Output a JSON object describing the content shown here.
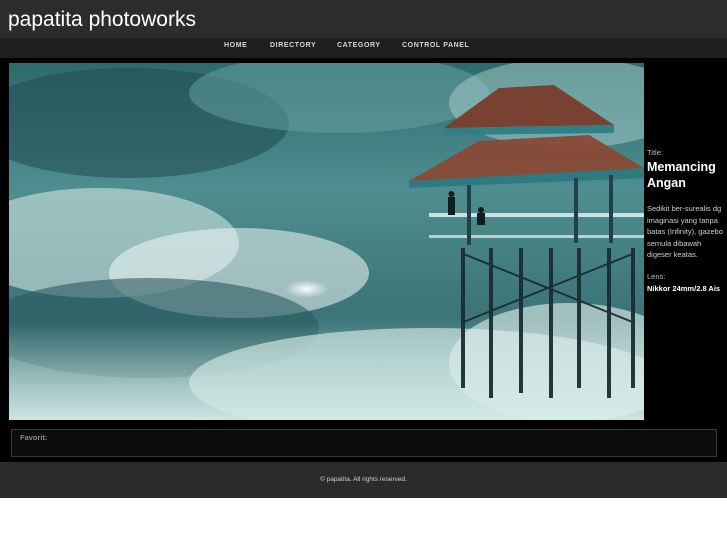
{
  "site": {
    "title": "papatita photoworks"
  },
  "nav": {
    "items": [
      "HOME",
      "DIRECTORY",
      "CATEGORY",
      "CONTROL PANEL"
    ]
  },
  "photo": {
    "title_label": "Title:",
    "title": "Memancing Angan",
    "description": "Sedikit ber-surealis dg imaginasi yang tanpa batas (Infinity), gazebo semula dibawah digeser keatas.",
    "lens_label": "Lens:",
    "lens": "Nikkor 24mm/2.8 Ais"
  },
  "favorit": {
    "label": "Favorit:"
  },
  "footer": {
    "copyright": "© papatita. All rights reserved."
  },
  "colors": {
    "header_bg": "#2c2c2c",
    "nav_bg": "#1e1e1e",
    "stage_bg": "#000000",
    "footer_bg": "#2b2b2b"
  }
}
